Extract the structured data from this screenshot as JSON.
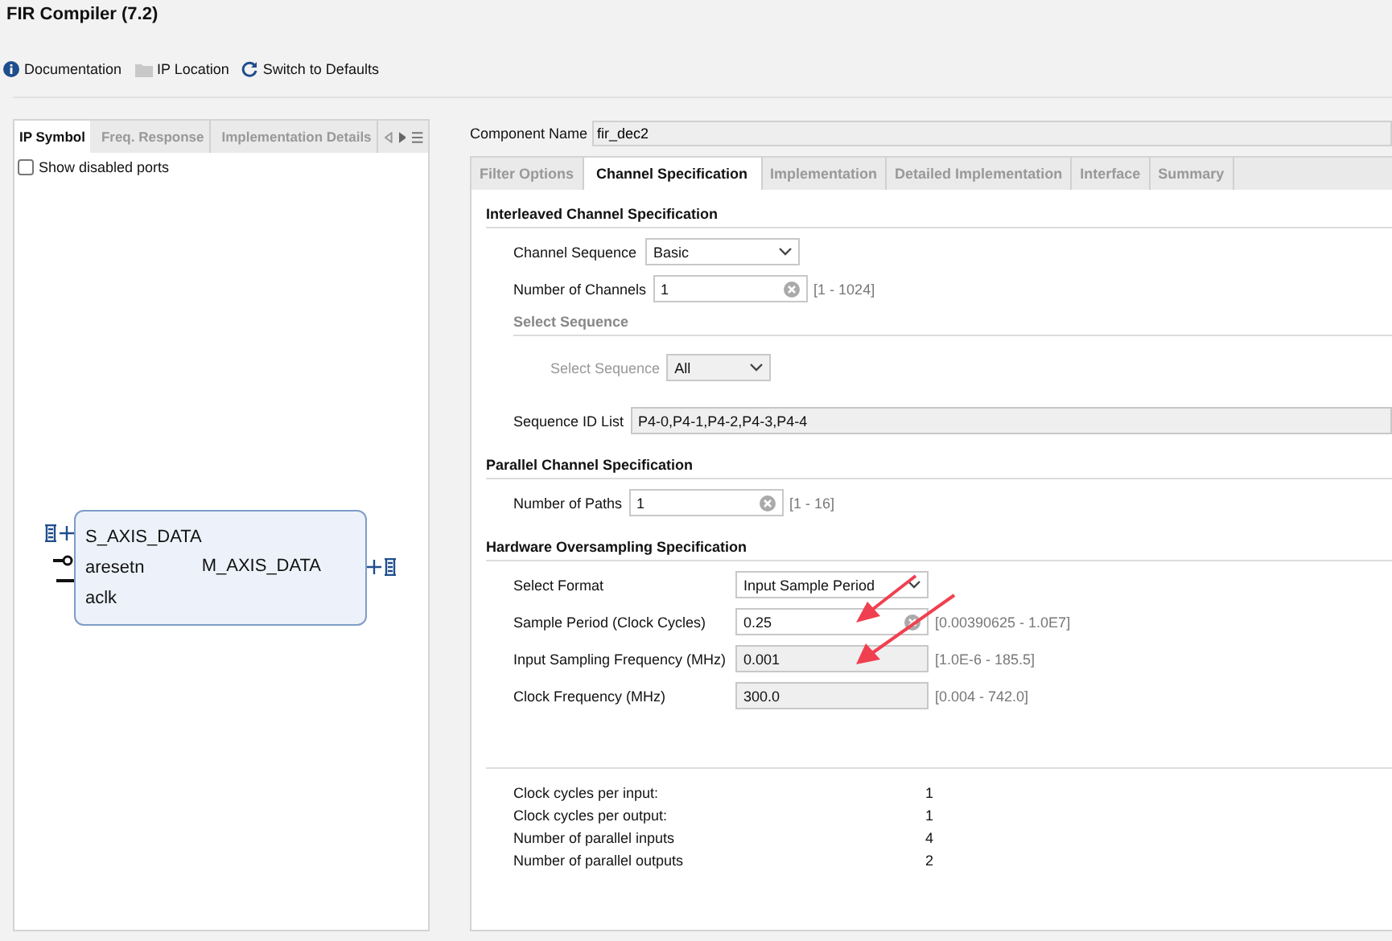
{
  "window": {
    "title": "FIR Compiler (7.2)"
  },
  "toolbar": [
    {
      "label": "Documentation",
      "kind": "info"
    },
    {
      "label": "IP Location",
      "kind": "folder"
    },
    {
      "label": "Switch to Defaults",
      "kind": "refresh"
    }
  ],
  "left_panel": {
    "tabs": [
      {
        "label": "IP Symbol",
        "selected": true
      },
      {
        "label": "Freq. Response",
        "selected": false
      },
      {
        "label": "Implementation Details",
        "selected": false
      }
    ],
    "show_disabled_ports": {
      "label": "Show disabled ports",
      "checked": false
    },
    "symbol": {
      "left_ports": [
        {
          "name": "S_AXIS_DATA",
          "kind": "bus"
        },
        {
          "name": "aresetn",
          "kind": "inverted"
        },
        {
          "name": "aclk",
          "kind": "wire"
        }
      ],
      "right_ports": [
        {
          "name": "M_AXIS_DATA",
          "kind": "bus"
        }
      ]
    }
  },
  "component_name": {
    "label": "Component Name",
    "value": "fir_dec2"
  },
  "tabs": [
    {
      "label": "Filter Options",
      "selected": false
    },
    {
      "label": "Channel Specification",
      "selected": true
    },
    {
      "label": "Implementation",
      "selected": false
    },
    {
      "label": "Detailed Implementation",
      "selected": false
    },
    {
      "label": "Interface",
      "selected": false
    },
    {
      "label": "Summary",
      "selected": false
    }
  ],
  "sections": [
    {
      "title": "Interleaved Channel Specification",
      "rows": [
        {
          "kind": "dropdown",
          "label": "Channel Sequence",
          "value": "Basic",
          "disabled": false
        },
        {
          "kind": "text",
          "label": "Number of Channels",
          "value": "1",
          "range": "[1 - 1024]",
          "disabled": false
        },
        {
          "kind": "subheading",
          "label": "Select Sequence",
          "disabled": true
        },
        {
          "kind": "dropdown",
          "label": "Select Sequence",
          "value": "All",
          "disabled": true
        },
        {
          "kind": "readonly",
          "label": "Sequence ID List",
          "value": "P4-0,P4-1,P4-2,P4-3,P4-4",
          "disabled": false
        }
      ]
    },
    {
      "title": "Parallel Channel Specification",
      "rows": [
        {
          "kind": "text",
          "label": "Number of Paths",
          "value": "1",
          "range": "[1 - 16]",
          "disabled": false
        }
      ]
    },
    {
      "title": "Hardware Oversampling Specification",
      "rows": [
        {
          "kind": "dropdown",
          "label": "Select Format",
          "value": "Input Sample Period",
          "disabled": false
        },
        {
          "kind": "text",
          "label": "Sample Period (Clock Cycles)",
          "value": "0.25",
          "range": "[0.00390625 - 1.0E7]",
          "disabled": false
        },
        {
          "kind": "readonly",
          "label": "Input Sampling Frequency (MHz)",
          "value": "0.001",
          "range": "[1.0E-6 - 185.5]",
          "disabled": false
        },
        {
          "kind": "readonly",
          "label": "Clock Frequency (MHz)",
          "value": "300.0",
          "range": "[0.004 - 742.0]",
          "disabled": false
        }
      ]
    }
  ],
  "summary": [
    {
      "label": "Clock cycles per input:",
      "value": "1"
    },
    {
      "label": "Clock cycles per output:",
      "value": "1"
    },
    {
      "label": "Number of parallel inputs",
      "value": "4"
    },
    {
      "label": "Number of parallel outputs",
      "value": "2"
    }
  ]
}
